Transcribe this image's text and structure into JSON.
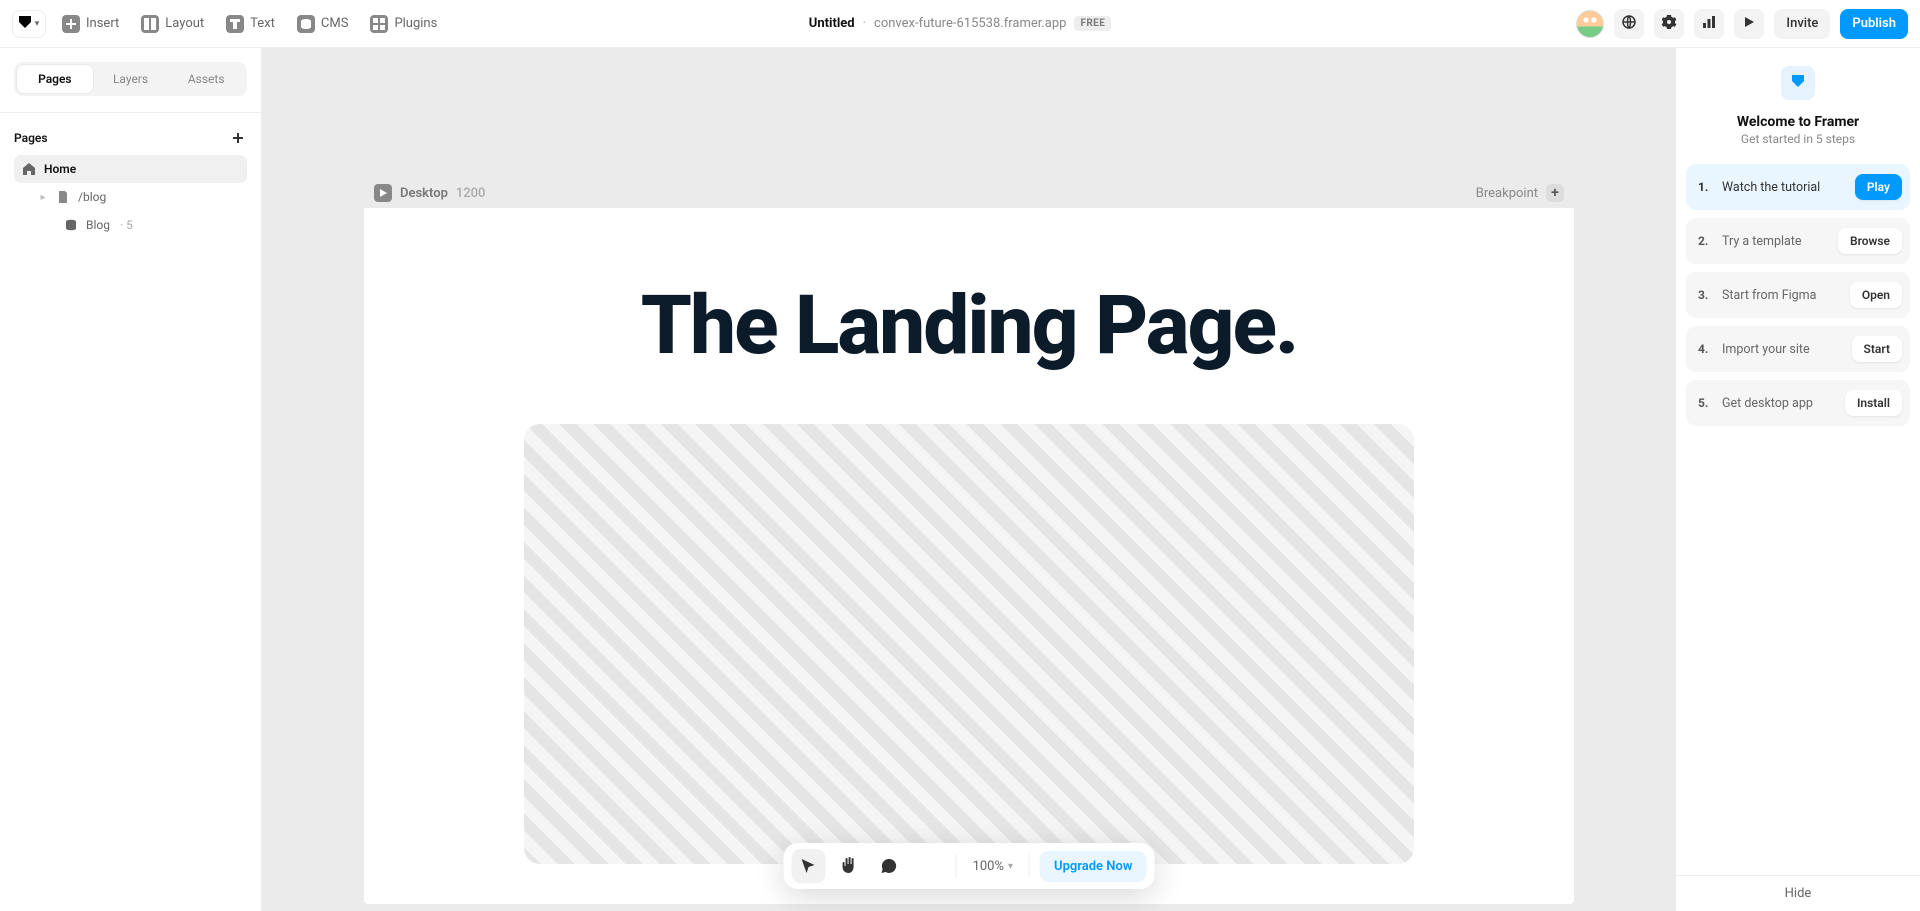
{
  "toolbar": {
    "menus": {
      "insert": "Insert",
      "layout": "Layout",
      "text": "Text",
      "cms": "CMS",
      "plugins": "Plugins"
    },
    "center": {
      "title": "Untitled",
      "domain": "convex-future-615538.framer.app",
      "badge": "FREE"
    },
    "right": {
      "invite": "Invite",
      "publish": "Publish"
    }
  },
  "left_sidebar": {
    "tabs": [
      "Pages",
      "Layers",
      "Assets"
    ],
    "section_title": "Pages",
    "pages": {
      "home": "Home",
      "blog": "/blog",
      "blog_child": "Blog",
      "blog_child_count": "· 5"
    }
  },
  "canvas": {
    "frame": {
      "device": "Desktop",
      "width": "1200",
      "breakpoint_label": "Breakpoint"
    },
    "headline": "The Landing Page."
  },
  "float_toolbar": {
    "zoom": "100%",
    "upgrade": "Upgrade Now"
  },
  "right_sidebar": {
    "title": "Welcome to Framer",
    "subtitle": "Get started in 5 steps",
    "steps": [
      {
        "num": "1.",
        "label": "Watch the tutorial",
        "action": "Play",
        "primary": true
      },
      {
        "num": "2.",
        "label": "Try a template",
        "action": "Browse",
        "primary": false
      },
      {
        "num": "3.",
        "label": "Start from Figma",
        "action": "Open",
        "primary": false
      },
      {
        "num": "4.",
        "label": "Import your site",
        "action": "Start",
        "primary": false
      },
      {
        "num": "5.",
        "label": "Get desktop app",
        "action": "Install",
        "primary": false
      }
    ],
    "hide": "Hide"
  }
}
